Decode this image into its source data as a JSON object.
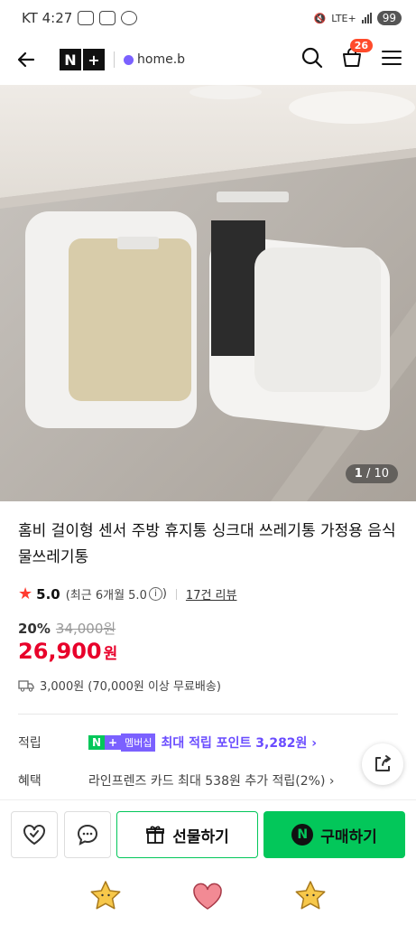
{
  "status_bar": {
    "carrier_time": "KT 4:27",
    "network": "LTE+",
    "battery": "99"
  },
  "header": {
    "logo_n": "N",
    "logo_plus": "+",
    "store": "home.b",
    "cart_count": "26"
  },
  "gallery": {
    "current": "1",
    "total": "/ 10"
  },
  "product": {
    "title": "홈비 걸이형 센서 주방 휴지통 싱크대 쓰레기통 가정용 음식물쓰레기통",
    "rating": "5.0",
    "rating_detail": "(최근 6개월 5.0",
    "info_glyph": "i",
    "rating_close": ")",
    "review_count": "17건 리뷰",
    "discount_rate": "20%",
    "original_price": "34,000원",
    "sale_price": "26,900",
    "sale_unit": "원",
    "shipping": "3,000원 (70,000원 이상 무료배송)"
  },
  "benefits": {
    "points_label": "적립",
    "membership_n": "N",
    "membership_plus": "+",
    "membership_tag": "멤버십",
    "points_text": "최대 적립 포인트 3,282원 ›",
    "card_label": "혜택",
    "card_text": "라인프렌즈 카드 최대 538원 추가 적립(2%) ›"
  },
  "actions": {
    "gift_label": "선물하기",
    "buy_label": "구매하기",
    "npay": "N"
  },
  "colors": {
    "brand_green": "#03c75a",
    "price_red": "#e8002a",
    "membership_purple": "#7b61ff",
    "badge_orange": "#ff4b2b"
  }
}
